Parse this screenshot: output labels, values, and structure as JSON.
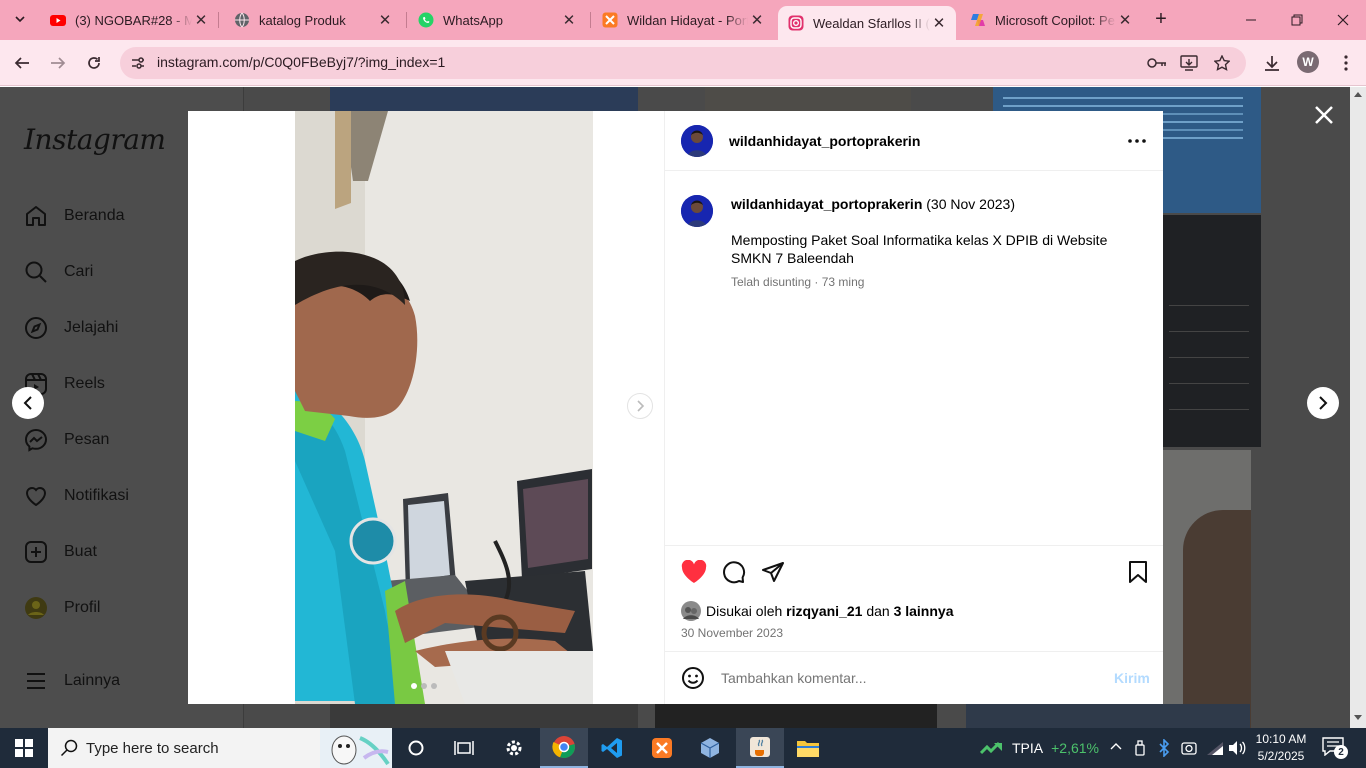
{
  "browser": {
    "tabs": [
      {
        "label": "(3) NGOBAR#28 - Me",
        "icon": "youtube-icon"
      },
      {
        "label": "katalog Produk",
        "icon": "globe-icon"
      },
      {
        "label": "WhatsApp",
        "icon": "whatsapp-icon"
      },
      {
        "label": "Wildan Hidayat - Port",
        "icon": "xampp-icon"
      },
      {
        "label": "Wealdan Sfarllos II (@",
        "icon": "instagram-icon",
        "active": true
      },
      {
        "label": "Microsoft Copilot: Pe",
        "icon": "copilot-icon"
      }
    ],
    "url": "instagram.com/p/C0Q0FBeByj7/?img_index=1",
    "profile_initial": "W"
  },
  "instagram": {
    "logo": "Instagram",
    "nav": [
      {
        "label": "Beranda",
        "icon": "home-icon"
      },
      {
        "label": "Cari",
        "icon": "search-icon"
      },
      {
        "label": "Jelajahi",
        "icon": "compass-icon"
      },
      {
        "label": "Reels",
        "icon": "reels-icon"
      },
      {
        "label": "Pesan",
        "icon": "messenger-icon"
      },
      {
        "label": "Notifikasi",
        "icon": "heart-icon"
      },
      {
        "label": "Buat",
        "icon": "plus-square-icon"
      },
      {
        "label": "Profil",
        "icon": "profile-avatar"
      },
      {
        "label": "Lainnya",
        "icon": "menu-icon"
      }
    ]
  },
  "post": {
    "username": "wildanhidayat_portoprakerin",
    "caption_date": "(30 Nov 2023)",
    "caption": "Memposting Paket Soal Informatika kelas X DPIB di Website SMKN 7 Baleendah",
    "edited": "Telah disunting · 73 ming",
    "likes_prefix": "Disukai oleh",
    "liked_by": "rizqyani_21",
    "likes_and": "dan",
    "likes_others": "3 lainnya",
    "date": "30 November 2023",
    "comment_placeholder": "Tambahkan komentar...",
    "send_label": "Kirim",
    "carousel_count": 3,
    "carousel_index": 1
  },
  "taskbar": {
    "search_placeholder": "Type here to search",
    "stock_name": "TPIA",
    "stock_change": "+2,61%",
    "time": "10:10 AM",
    "date": "5/2/2025",
    "notifications": "2"
  },
  "colors": {
    "tabstrip": "#f5a6bc",
    "toolbar": "#fde7ee",
    "like_red": "#ff3040",
    "send_blue": "#b3dbff",
    "stock_green": "#4cc26b"
  }
}
